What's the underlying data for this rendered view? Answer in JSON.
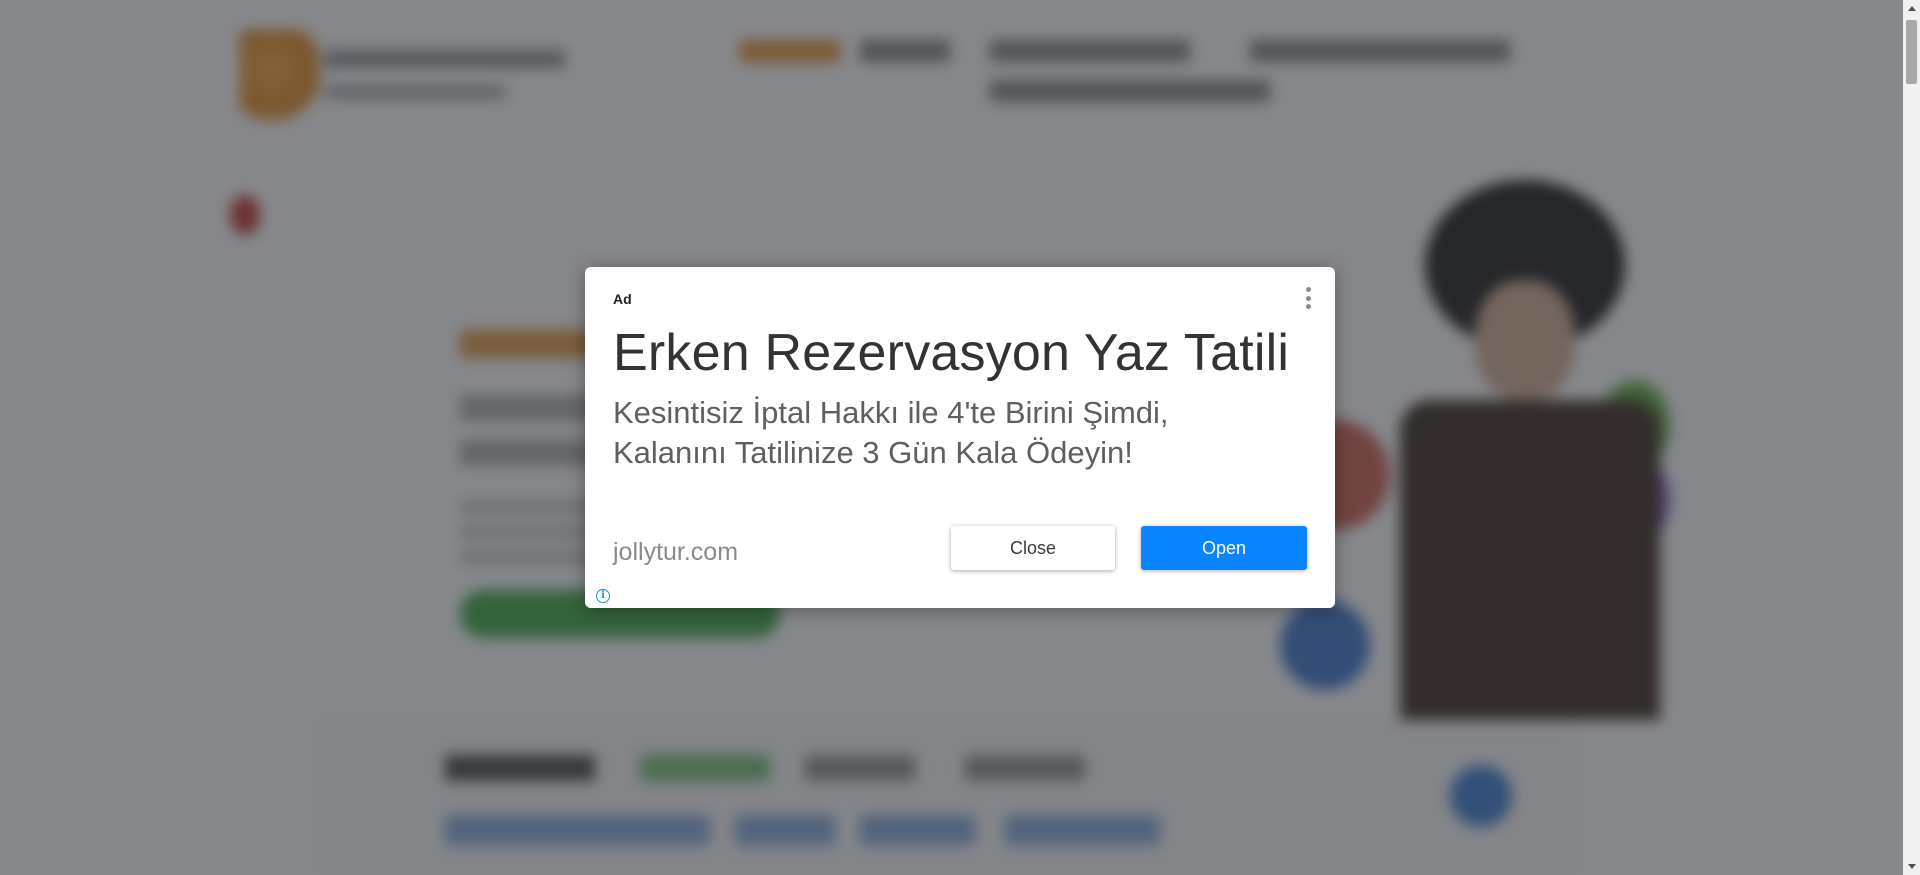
{
  "ad": {
    "label": "Ad",
    "title": "Erken Rezervasyon Yaz Tatili",
    "description": "Kesintisiz İptal Hakkı ile 4'te Birini Şimdi, Kalanını Tatilinize 3 Gün Kala Ödeyin!",
    "domain": "jollytur.com",
    "close_label": "Close",
    "open_label": "Open",
    "info_glyph": "i",
    "menu_icon": "more-vert-icon",
    "accent_color": "#0a84ff"
  },
  "overlay_color": "#20252b"
}
